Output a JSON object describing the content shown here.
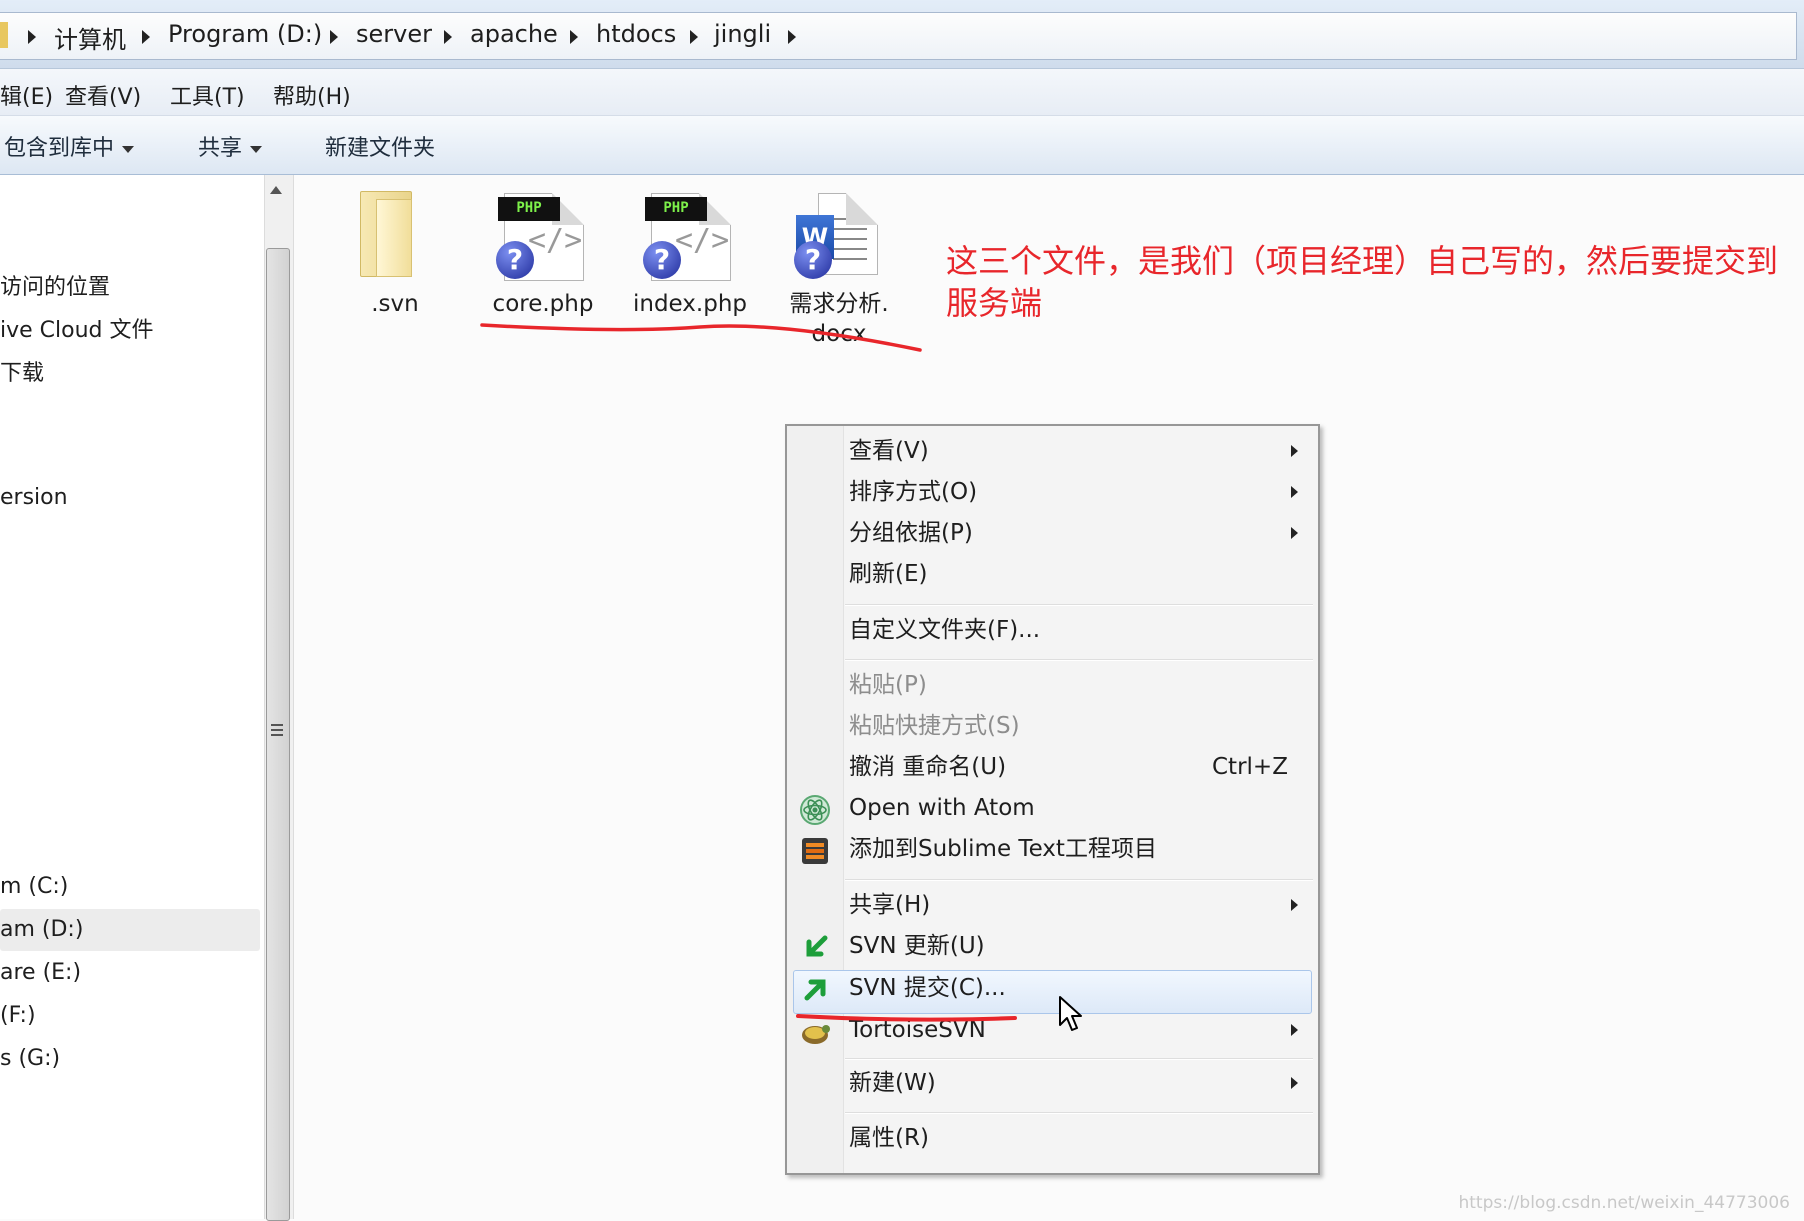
{
  "address": {
    "crumbs": [
      "计算机",
      "Program (D:)",
      "server",
      "apache",
      "htdocs",
      "jingli"
    ]
  },
  "menubar": {
    "items": [
      "辑(E)",
      "查看(V)",
      "工具(T)",
      "帮助(H)"
    ]
  },
  "toolbar": {
    "include_library": "包含到库中",
    "share": "共享",
    "new_folder": "新建文件夹"
  },
  "nav": {
    "items": [
      "访问的位置",
      "ive Cloud 文件",
      "下载",
      "ersion",
      "m (C:)",
      "am (D:)",
      "are (E:)",
      "(F:)",
      "s (G:)"
    ]
  },
  "files": [
    {
      "label": ".svn",
      "type": "folder"
    },
    {
      "label": "core.php",
      "type": "php",
      "badge": "PHP"
    },
    {
      "label": "index.php",
      "type": "php",
      "badge": "PHP"
    },
    {
      "label": "需求分析.\ndocx",
      "type": "docx"
    }
  ],
  "note": "这三个文件，是我们（项目经理）自己写的，然后要提交到服务端",
  "context_menu": {
    "view": "查看(V)",
    "sort": "排序方式(O)",
    "group": "分组依据(P)",
    "refresh": "刷新(E)",
    "customize": "自定义文件夹(F)...",
    "paste": "粘贴(P)",
    "paste_shortcut": "粘贴快捷方式(S)",
    "undo_rename": "撤消 重命名(U)",
    "undo_shortcut": "Ctrl+Z",
    "open_atom": "Open with Atom",
    "add_sublime": "添加到Sublime Text工程项目",
    "share": "共享(H)",
    "svn_update": "SVN 更新(U)",
    "svn_commit": "SVN 提交(C)...",
    "tortoise": "TortoiseSVN",
    "new": "新建(W)",
    "properties": "属性(R)"
  },
  "colors": {
    "annotation": "#e8262b",
    "highlight": "#dde9f8"
  },
  "watermark": "https://blog.csdn.net/weixin_44773006"
}
